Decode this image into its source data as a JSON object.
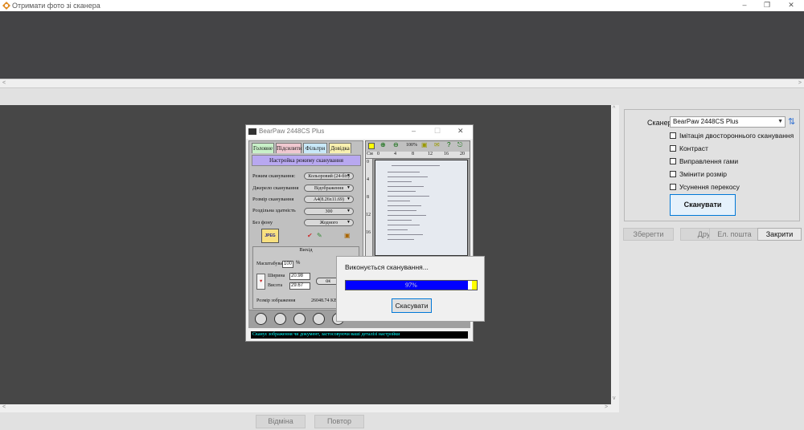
{
  "window": {
    "title": "Отримати фото зі сканера",
    "minimize": "–",
    "maximize": "❐",
    "close": "✕"
  },
  "right_panel": {
    "scanner_label": "Сканер:",
    "scanner_value": "BearPaw 2448CS Plus",
    "options": [
      {
        "label": "Імітація двостороннього сканування",
        "checked": false
      },
      {
        "label": "Контраст",
        "checked": false
      },
      {
        "label": "Виправлення гами",
        "checked": false
      },
      {
        "label": "Змінити розмір",
        "checked": false
      },
      {
        "label": "Усунення перекосу",
        "checked": false
      }
    ],
    "scan_button": "Сканувати",
    "actions": {
      "save": "Зберегти",
      "print": "Друк",
      "email": "Ел. пошта",
      "close": "Закрити"
    }
  },
  "bottom": {
    "undo": "Відміна",
    "repeat": "Повтор"
  },
  "scanner_dialog": {
    "title": "BearPaw 2448CS Plus",
    "tabs": [
      "Головне",
      "Підсилити",
      "Фільтри",
      "Довідка"
    ],
    "section_title": "Настройка режиму сканування",
    "fields": [
      {
        "label": "Режим сканування:",
        "value": "Кольоровий (24-біт)"
      },
      {
        "label": "Джерело сканування",
        "value": "Відображення"
      },
      {
        "label": "Розмір сканування",
        "value": "A4(8.26x11.69)"
      },
      {
        "label": "Роздільна здатність",
        "value": "300"
      },
      {
        "label": "Без фону",
        "value": "Жодного"
      }
    ],
    "jpeg_label": "JPEG 2000",
    "output_title": "Вихід",
    "scale_label": "Масштабування",
    "scale_value": "100",
    "scale_unit": "%",
    "width_label": "Ширина",
    "width_value": "20.98",
    "height_label": "Висота",
    "height_value": "29.67",
    "ok_label": "ок",
    "image_size_label": "Розмір зображення",
    "image_size_value": "26048.74 KB",
    "zoom_label": "100%",
    "ruler_unit": "См",
    "ruler_ticks": [
      "0",
      "4",
      "8",
      "12",
      "16",
      "20"
    ],
    "vruler_ticks": [
      "0",
      "4",
      "8",
      "12",
      "16"
    ],
    "status": "Сканує зображення чи документ, застосовуючи ваші деталізі настройки"
  },
  "progress_dialog": {
    "label": "Виконується сканування...",
    "percent": 97,
    "percent_text": "97%",
    "cancel": "Скасувати",
    "colors": {
      "fill": "#0000ff",
      "end": "#ffff00"
    }
  }
}
